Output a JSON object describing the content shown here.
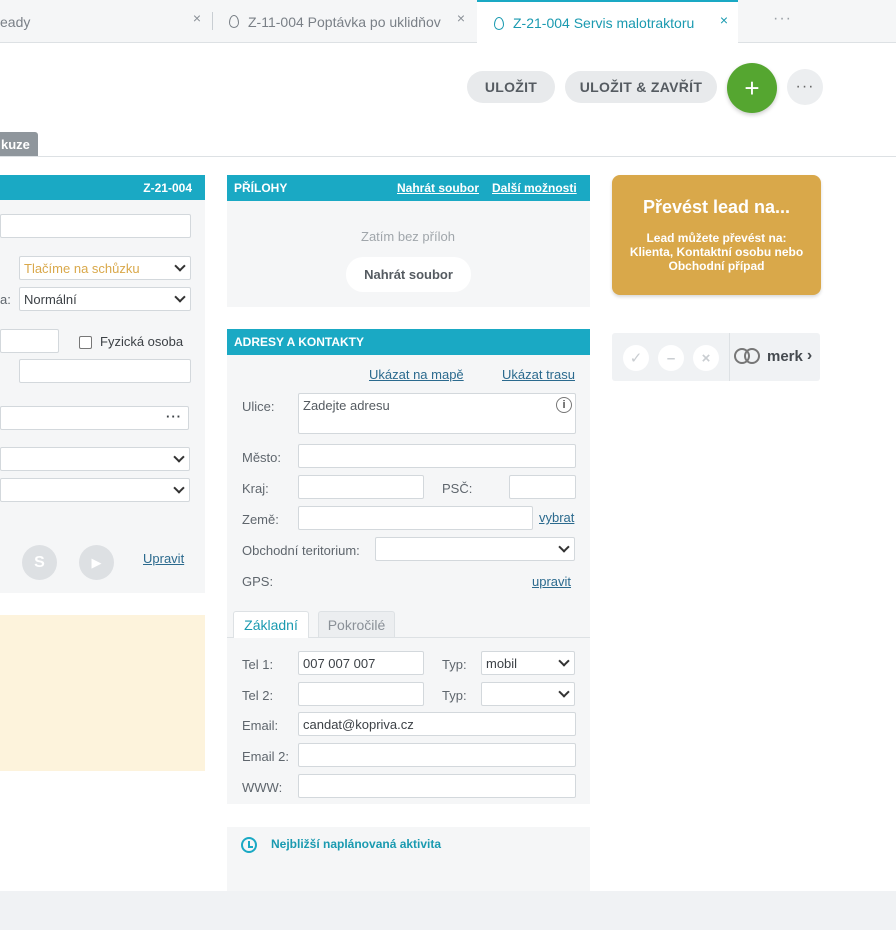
{
  "tabs": [
    {
      "label": "eady",
      "close": "×"
    },
    {
      "label": "Z-11-004 Poptávka po uklidňov",
      "close": "×"
    },
    {
      "label": "Z-21-004 Servis malotraktoru",
      "close": "×",
      "active": true
    }
  ],
  "tab_more": "···",
  "toolbar": {
    "save": "ULOŽIT",
    "save_close": "ULOŽIT & ZAVŘÍT",
    "add": "+",
    "more": "···"
  },
  "section_tab": "kuze",
  "left": {
    "header_id": "Z-21-004",
    "stage_value": "Tlačíme na schůzku",
    "priority_label": "a:",
    "priority_value": "Normální",
    "person_checkbox": "Fyzická osoba",
    "dots": "···",
    "social": {
      "skype": "S",
      "youtube": "▶"
    },
    "edit_link": "Upravit"
  },
  "attachments": {
    "title": "PŘÍLOHY",
    "upload_link": "Nahrát soubor",
    "more_link": "Další možnosti",
    "empty": "Zatím bez příloh",
    "upload_button": "Nahrát soubor"
  },
  "address": {
    "title": "ADRESY A KONTAKTY",
    "map_link": "Ukázat na mapě",
    "route_link": "Ukázat trasu",
    "street_label": "Ulice:",
    "street_placeholder": "Zadejte adresu",
    "city_label": "Město:",
    "region_label": "Kraj:",
    "zip_label": "PSČ:",
    "country_label": "Země:",
    "choose_link": "vybrat",
    "territory_label": "Obchodní teritorium:",
    "gps_label": "GPS:",
    "gps_edit": "upravit",
    "tab_basic": "Základní",
    "tab_advanced": "Pokročilé",
    "tel1_label": "Tel 1:",
    "tel1_value": "007 007 007",
    "type_label": "Typ:",
    "type1_value": "mobil",
    "tel2_label": "Tel 2:",
    "email_label": "Email:",
    "email_value": "candat@kopriva.cz",
    "email2_label": "Email 2:",
    "www_label": "WWW:"
  },
  "activity": {
    "title": "Nejbližší naplánovaná aktivita"
  },
  "lead_card": {
    "title": "Převést lead na...",
    "text": "Lead můžete převést na: Klienta, Kontaktní osobu nebo Obchodní případ"
  },
  "merk": {
    "check": "✓",
    "minus": "–",
    "cross": "×",
    "logo": "merk",
    "arrow": "›"
  }
}
